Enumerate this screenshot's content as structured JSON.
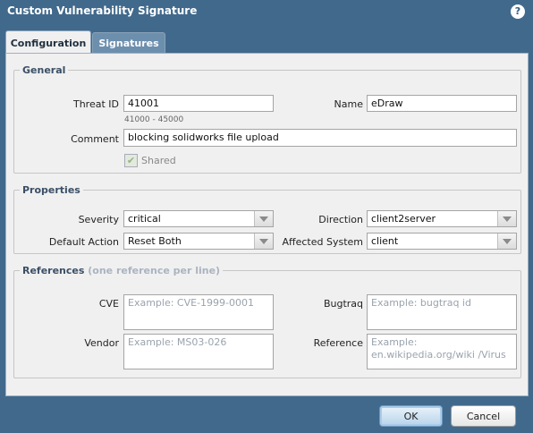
{
  "window": {
    "title": "Custom Vulnerability Signature",
    "help_icon": "?"
  },
  "tabs": [
    {
      "label": "Configuration",
      "active": true
    },
    {
      "label": "Signatures",
      "active": false
    }
  ],
  "general": {
    "legend": "General",
    "threat_id": {
      "label": "Threat ID",
      "value": "41001",
      "range_hint": "41000 - 45000"
    },
    "name": {
      "label": "Name",
      "value": "eDraw"
    },
    "comment": {
      "label": "Comment",
      "value": "blocking solidworks file upload"
    },
    "shared": {
      "label": "Shared",
      "checked": true
    }
  },
  "properties": {
    "legend": "Properties",
    "severity": {
      "label": "Severity",
      "value": "critical"
    },
    "direction": {
      "label": "Direction",
      "value": "client2server"
    },
    "default_action": {
      "label": "Default Action",
      "value": "Reset Both"
    },
    "affected_system": {
      "label": "Affected System",
      "value": "client"
    }
  },
  "references": {
    "legend": "References",
    "legend_hint": "(one reference per line)",
    "cve": {
      "label": "CVE",
      "placeholder": "Example: CVE-1999-0001"
    },
    "bugtraq": {
      "label": "Bugtraq",
      "placeholder": "Example: bugtraq id"
    },
    "vendor": {
      "label": "Vendor",
      "placeholder": "Example: MS03-026"
    },
    "reference": {
      "label": "Reference",
      "placeholder": "Example: en.wikipedia.org/wiki /Virus"
    }
  },
  "buttons": {
    "ok": "OK",
    "cancel": "Cancel"
  },
  "colors": {
    "titlebar": "#41698c",
    "panel": "#f0f0f0",
    "legend": "#3a4f66"
  }
}
